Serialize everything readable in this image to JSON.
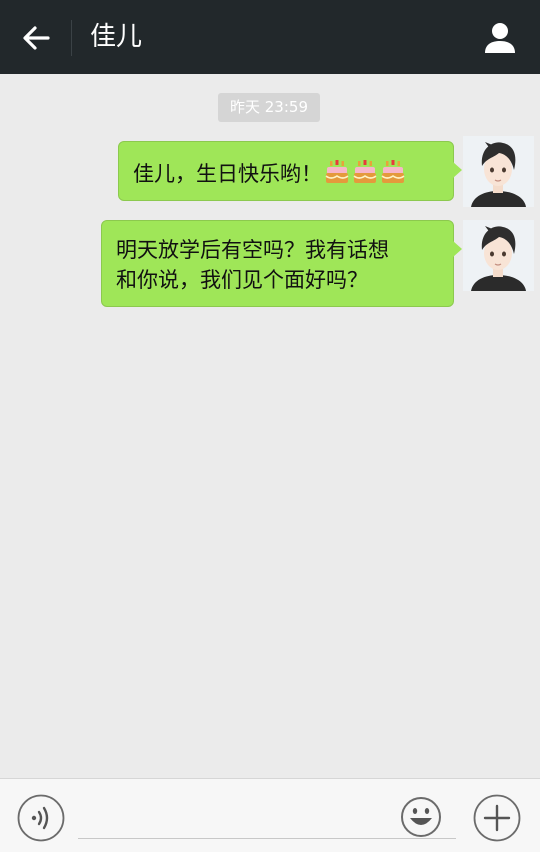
{
  "header": {
    "title": "佳儿",
    "back_icon": "back-arrow-icon",
    "profile_icon": "person-icon",
    "background": "#22282b"
  },
  "chat": {
    "timestamp": "昨天 23:59",
    "messages": [
      {
        "sender": "me",
        "text": "佳儿，生日快乐哟！",
        "emojis": [
          "cake-emoji",
          "cake-emoji",
          "cake-emoji"
        ]
      },
      {
        "sender": "me",
        "line1": "明天放学后有空吗？我有话想",
        "line2": "和你说，我们见个面好吗？"
      }
    ],
    "bubble_color": "#9fe658",
    "background": "#ebebeb"
  },
  "input_bar": {
    "voice_icon": "voice-icon",
    "text_value": "",
    "emoji_icon": "smiley-icon",
    "plus_icon": "plus-icon"
  }
}
